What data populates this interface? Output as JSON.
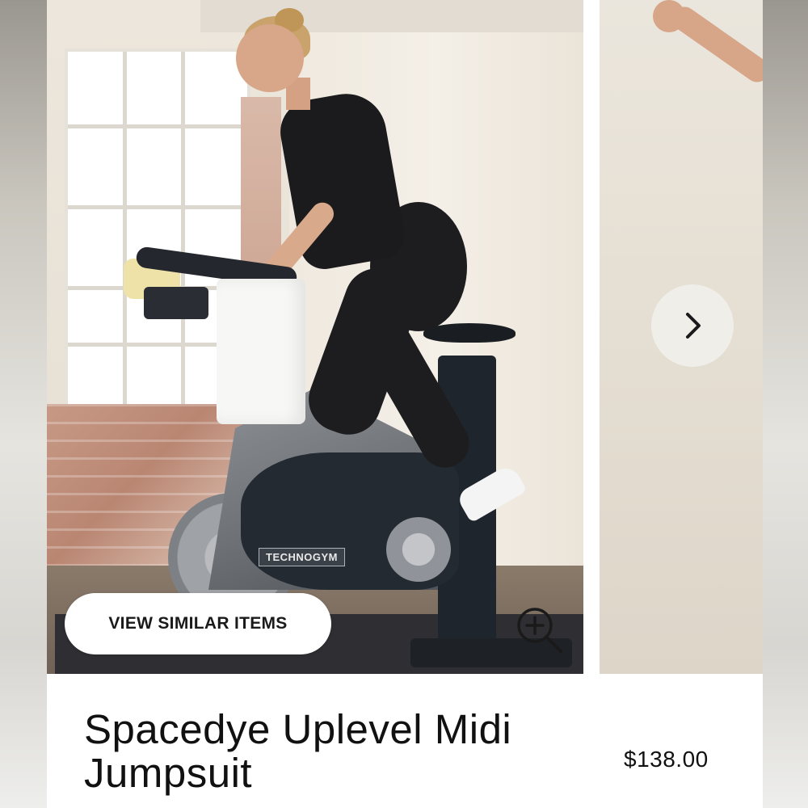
{
  "product": {
    "title": "Spacedye Uplevel Midi Jumpsuit",
    "price": "$138.00"
  },
  "gallery": {
    "main_image_alt": "Woman wearing black jumpsuit riding a stationary bike",
    "bike_brand": "TECHNOGYM",
    "view_similar_label": "VIEW SIMILAR ITEMS",
    "zoom_icon": "zoom-in-icon",
    "next_icon": "chevron-right-icon"
  },
  "colors": {
    "text": "#111111",
    "button_bg": "#ffffff",
    "arrow_bg": "#f0eeea"
  }
}
